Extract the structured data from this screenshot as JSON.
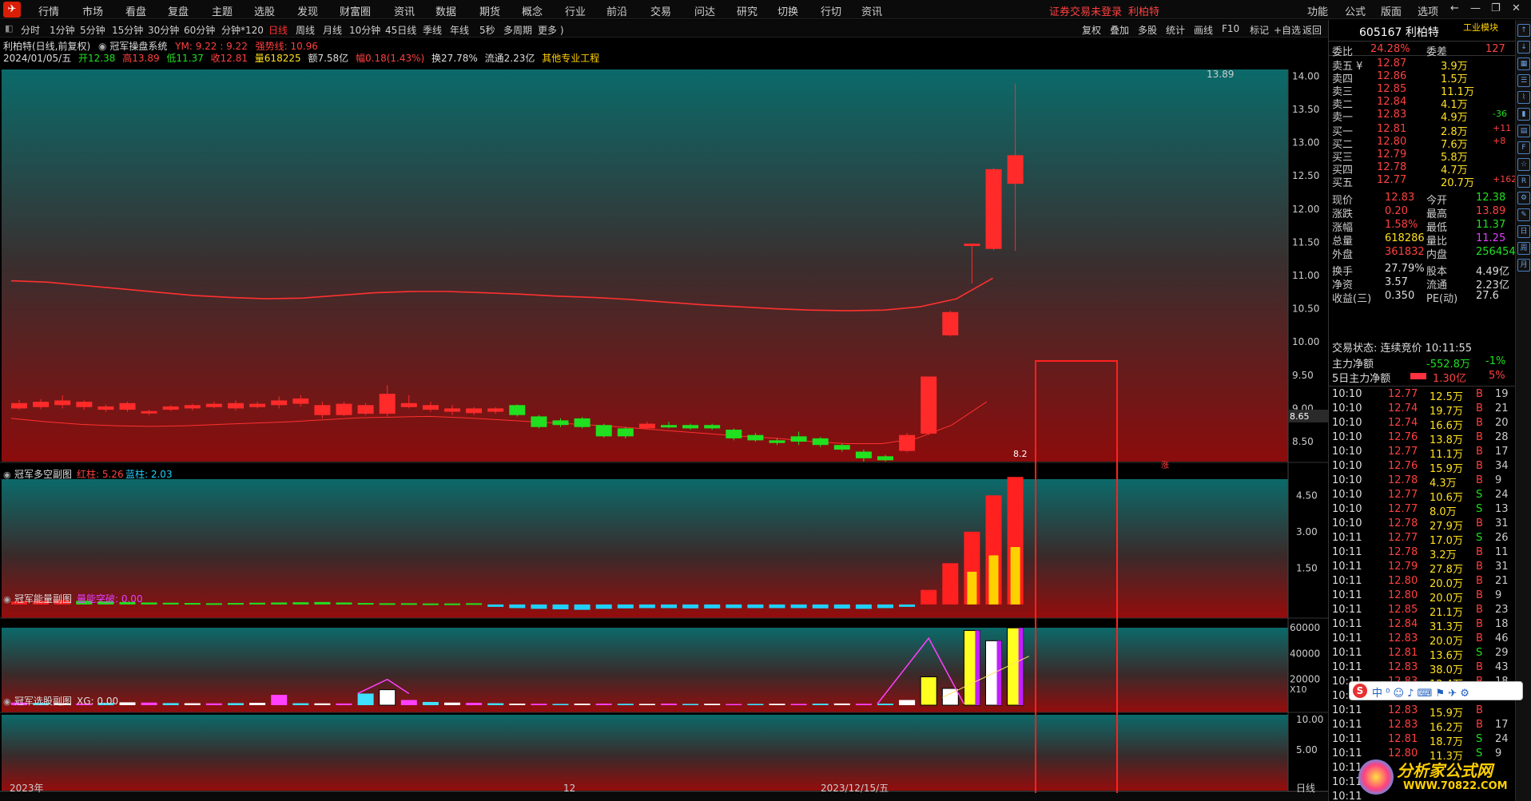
{
  "menu": [
    "行情",
    "市场",
    "看盘",
    "复盘",
    "主题",
    "选股",
    "发现",
    "财富圈",
    "资讯",
    "数据",
    "期货",
    "概念",
    "行业",
    "前沿",
    "交易",
    "问达",
    "研究",
    "切换",
    "行切",
    "资讯"
  ],
  "login_status": "证券交易未登录",
  "login_stock": "利柏特",
  "top_right_menu": [
    "功能",
    "公式",
    "版面",
    "选项"
  ],
  "timeframes": [
    "分时",
    "1分钟",
    "5分钟",
    "15分钟",
    "30分钟",
    "60分钟",
    "分钟*120",
    "日线",
    "周线",
    "月线",
    "10分钟",
    "45日线",
    "季线",
    "年线",
    "5秒",
    "多周期",
    "更多 )"
  ],
  "active_timeframe": "日线",
  "toolbar_right": [
    "复权",
    "叠加",
    "多股",
    "统计",
    "画线",
    "F10",
    "标记",
    "+自选",
    "返回"
  ],
  "stock": {
    "name": "利柏特",
    "code": "605167",
    "title": "605167 利柏特",
    "sector_tag": "工业模块",
    "chart_label": "利柏特(日线,前复权)",
    "system_name": "冠军操盘系统",
    "ym_label": "YM: 9.22 : 9.22",
    "strong_line": "强势线: 10.96",
    "date": "2024/01/05/五",
    "open": "开12.38",
    "high": "高13.89",
    "low": "低11.37",
    "close": "收12.81",
    "volume": "量618225",
    "amount": "额7.58亿",
    "amplitude": "幅0.18(1.43%)",
    "turnover": "换27.78%",
    "float_cap": "流通2.23亿",
    "extra": "其他专业工程"
  },
  "main_axis": [
    "14.00",
    "13.50",
    "13.00",
    "12.50",
    "12.00",
    "11.50",
    "11.00",
    "10.50",
    "10.00",
    "9.50",
    "9.00",
    "8.50"
  ],
  "price_marker": "8.65",
  "peak_label": "13.89",
  "low_label": "8.2",
  "zhang_label": "涨",
  "sub1": {
    "title": "冠军多空副图",
    "red_label": "红柱: 5.26",
    "blue_label": "蓝柱: 2.03",
    "axis": [
      "4.50",
      "3.00",
      "1.50"
    ]
  },
  "sub2": {
    "title": "冠军能量副图",
    "label": "量能突破: 0.00",
    "axis": [
      "60000",
      "40000",
      "20000"
    ],
    "unit": "X10"
  },
  "sub3": {
    "title": "冠军选股副图",
    "label": "XG: 0.00",
    "axis": [
      "10.00",
      "5.00"
    ]
  },
  "date_axis": [
    "2023年",
    "12",
    "2023/12/15/五",
    "日线"
  ],
  "order_book": {
    "weibi_label": "委比",
    "weibi": "24.28%",
    "weicha_label": "委差",
    "weicha": "127",
    "asks": [
      {
        "label": "卖五 ¥",
        "price": "12.87",
        "vol": "3.9万",
        "chg": ""
      },
      {
        "label": "卖四",
        "price": "12.86",
        "vol": "1.5万",
        "chg": ""
      },
      {
        "label": "卖三",
        "price": "12.85",
        "vol": "11.1万",
        "chg": ""
      },
      {
        "label": "卖二",
        "price": "12.84",
        "vol": "4.1万",
        "chg": ""
      },
      {
        "label": "卖一",
        "price": "12.83",
        "vol": "4.9万",
        "chg": "-36"
      }
    ],
    "bids": [
      {
        "label": "买一",
        "price": "12.81",
        "vol": "2.8万",
        "chg": "+11"
      },
      {
        "label": "买二",
        "price": "12.80",
        "vol": "7.6万",
        "chg": "+8"
      },
      {
        "label": "买三",
        "price": "12.79",
        "vol": "5.8万",
        "chg": ""
      },
      {
        "label": "买四",
        "price": "12.78",
        "vol": "4.7万",
        "chg": ""
      },
      {
        "label": "买五",
        "price": "12.77",
        "vol": "20.7万",
        "chg": "+162"
      }
    ]
  },
  "quote": [
    {
      "k1": "现价",
      "v1": "12.83",
      "k2": "今开",
      "v2": "12.38"
    },
    {
      "k1": "涨跌",
      "v1": "0.20",
      "k2": "最高",
      "v2": "13.89"
    },
    {
      "k1": "涨幅",
      "v1": "1.58%",
      "k2": "最低",
      "v2": "11.37"
    },
    {
      "k1": "总量",
      "v1": "618286",
      "k2": "量比",
      "v2": "11.25"
    },
    {
      "k1": "外盘",
      "v1": "361832",
      "k2": "内盘",
      "v2": "256454"
    },
    {
      "k1": "换手",
      "v1": "27.79%",
      "k2": "股本",
      "v2": "4.49亿"
    },
    {
      "k1": "净资",
      "v1": "3.57",
      "k2": "流通",
      "v2": "2.23亿"
    },
    {
      "k1": "收益(三)",
      "v1": "0.350",
      "k2": "PE(动)",
      "v2": "27.6"
    }
  ],
  "trade_status": "交易状态: 连续竞价 10:11:55",
  "main_net": {
    "label": "主力净额",
    "value": "-552.8万",
    "pct": "-1%"
  },
  "main_net5": {
    "label": "5日主力净额",
    "value": "1.30亿",
    "pct": "5%"
  },
  "ticks": [
    {
      "t": "10:10",
      "p": "12.77",
      "v": "12.5万",
      "s": "B",
      "n": "19"
    },
    {
      "t": "10:10",
      "p": "12.74",
      "v": "19.7万",
      "s": "B",
      "n": "21"
    },
    {
      "t": "10:10",
      "p": "12.74",
      "v": "16.6万",
      "s": "B",
      "n": "20"
    },
    {
      "t": "10:10",
      "p": "12.76",
      "v": "13.8万",
      "s": "B",
      "n": "28"
    },
    {
      "t": "10:10",
      "p": "12.77",
      "v": "11.1万",
      "s": "B",
      "n": "17"
    },
    {
      "t": "10:10",
      "p": "12.76",
      "v": "15.9万",
      "s": "B",
      "n": "34"
    },
    {
      "t": "10:10",
      "p": "12.78",
      "v": "4.3万",
      "s": "B",
      "n": "9"
    },
    {
      "t": "10:10",
      "p": "12.77",
      "v": "10.6万",
      "s": "S",
      "n": "24"
    },
    {
      "t": "10:10",
      "p": "12.77",
      "v": "8.0万",
      "s": "S",
      "n": "13"
    },
    {
      "t": "10:10",
      "p": "12.78",
      "v": "27.9万",
      "s": "B",
      "n": "31"
    },
    {
      "t": "10:11",
      "p": "12.77",
      "v": "17.0万",
      "s": "S",
      "n": "26"
    },
    {
      "t": "10:11",
      "p": "12.78",
      "v": "3.2万",
      "s": "B",
      "n": "11"
    },
    {
      "t": "10:11",
      "p": "12.79",
      "v": "27.8万",
      "s": "B",
      "n": "31"
    },
    {
      "t": "10:11",
      "p": "12.80",
      "v": "20.0万",
      "s": "B",
      "n": "21"
    },
    {
      "t": "10:11",
      "p": "12.80",
      "v": "20.0万",
      "s": "B",
      "n": "9"
    },
    {
      "t": "10:11",
      "p": "12.85",
      "v": "21.1万",
      "s": "B",
      "n": "23"
    },
    {
      "t": "10:11",
      "p": "12.84",
      "v": "31.3万",
      "s": "B",
      "n": "18"
    },
    {
      "t": "10:11",
      "p": "12.83",
      "v": "20.0万",
      "s": "B",
      "n": "46"
    },
    {
      "t": "10:11",
      "p": "12.81",
      "v": "13.6万",
      "s": "S",
      "n": "29"
    },
    {
      "t": "10:11",
      "p": "12.83",
      "v": "38.0万",
      "s": "B",
      "n": "43"
    },
    {
      "t": "10:11",
      "p": "12.83",
      "v": "12.4万",
      "s": "B",
      "n": "18"
    },
    {
      "t": "10:11",
      "p": "12.83",
      "v": "",
      "s": "",
      "n": ""
    },
    {
      "t": "10:11",
      "p": "12.83",
      "v": "15.9万",
      "s": "B",
      "n": ""
    },
    {
      "t": "10:11",
      "p": "12.83",
      "v": "16.2万",
      "s": "B",
      "n": "17"
    },
    {
      "t": "10:11",
      "p": "12.81",
      "v": "18.7万",
      "s": "S",
      "n": "24"
    },
    {
      "t": "10:11",
      "p": "12.80",
      "v": "11.3万",
      "s": "S",
      "n": "9"
    },
    {
      "t": "10:11",
      "p": "",
      "v": "",
      "s": "",
      "n": ""
    },
    {
      "t": "10:11",
      "p": "",
      "v": "",
      "s": "",
      "n": ""
    },
    {
      "t": "10:11",
      "p": "",
      "v": "",
      "s": "",
      "n": ""
    }
  ],
  "watermark": {
    "line1": "分析家公式网",
    "line2": "WWW.70822.COM"
  },
  "colors": {
    "up": "#ff2a2a",
    "down": "#20e020",
    "accent": "#ff3030",
    "cyan": "#00d8ff",
    "magenta": "#e020ff",
    "yellow": "#ffe020"
  },
  "chart_data": {
    "type": "candlestick",
    "price_ylim": [
      8.2,
      14.1
    ],
    "candles": [
      {
        "o": 9.0,
        "c": 9.08,
        "h": 9.13,
        "l": 8.98
      },
      {
        "o": 9.02,
        "c": 9.1,
        "h": 9.14,
        "l": 8.99
      },
      {
        "o": 9.05,
        "c": 9.12,
        "h": 9.2,
        "l": 9.0
      },
      {
        "o": 9.02,
        "c": 9.1,
        "h": 9.12,
        "l": 8.98
      },
      {
        "o": 8.98,
        "c": 9.03,
        "h": 9.06,
        "l": 8.95
      },
      {
        "o": 8.98,
        "c": 9.08,
        "h": 9.1,
        "l": 8.95
      },
      {
        "o": 8.93,
        "c": 8.96,
        "h": 8.98,
        "l": 8.9
      },
      {
        "o": 8.98,
        "c": 9.03,
        "h": 9.05,
        "l": 8.96
      },
      {
        "o": 9.0,
        "c": 9.05,
        "h": 9.07,
        "l": 8.97
      },
      {
        "o": 9.02,
        "c": 9.07,
        "h": 9.1,
        "l": 9.0
      },
      {
        "o": 9.0,
        "c": 9.08,
        "h": 9.12,
        "l": 8.97
      },
      {
        "o": 9.02,
        "c": 9.07,
        "h": 9.1,
        "l": 9.0
      },
      {
        "o": 9.05,
        "c": 9.12,
        "h": 9.18,
        "l": 9.0
      },
      {
        "o": 9.07,
        "c": 9.15,
        "h": 9.2,
        "l": 9.03
      },
      {
        "o": 8.9,
        "c": 9.05,
        "h": 9.1,
        "l": 8.85
      },
      {
        "o": 8.9,
        "c": 9.07,
        "h": 9.1,
        "l": 8.88
      },
      {
        "o": 8.92,
        "c": 9.05,
        "h": 9.08,
        "l": 8.9
      },
      {
        "o": 8.92,
        "c": 9.22,
        "h": 9.35,
        "l": 8.88
      },
      {
        "o": 9.02,
        "c": 9.08,
        "h": 9.2,
        "l": 9.0
      },
      {
        "o": 8.98,
        "c": 9.05,
        "h": 9.1,
        "l": 8.95
      },
      {
        "o": 8.95,
        "c": 9.0,
        "h": 9.05,
        "l": 8.9
      },
      {
        "o": 8.93,
        "c": 9.0,
        "h": 9.02,
        "l": 8.9
      },
      {
        "o": 8.95,
        "c": 9.0,
        "h": 9.02,
        "l": 8.92
      },
      {
        "o": 9.05,
        "c": 8.9,
        "h": 9.06,
        "l": 8.88
      },
      {
        "o": 8.88,
        "c": 8.72,
        "h": 8.9,
        "l": 8.7
      },
      {
        "o": 8.82,
        "c": 8.75,
        "h": 8.85,
        "l": 8.72
      },
      {
        "o": 8.85,
        "c": 8.72,
        "h": 8.87,
        "l": 8.7
      },
      {
        "o": 8.75,
        "c": 8.58,
        "h": 8.77,
        "l": 8.56
      },
      {
        "o": 8.7,
        "c": 8.58,
        "h": 8.72,
        "l": 8.55
      },
      {
        "o": 8.7,
        "c": 8.77,
        "h": 8.8,
        "l": 8.68
      },
      {
        "o": 8.75,
        "c": 8.72,
        "h": 8.8,
        "l": 8.7
      },
      {
        "o": 8.75,
        "c": 8.7,
        "h": 8.77,
        "l": 8.68
      },
      {
        "o": 8.75,
        "c": 8.7,
        "h": 8.77,
        "l": 8.68
      },
      {
        "o": 8.68,
        "c": 8.55,
        "h": 8.7,
        "l": 8.52
      },
      {
        "o": 8.6,
        "c": 8.52,
        "h": 8.63,
        "l": 8.5
      },
      {
        "o": 8.52,
        "c": 8.48,
        "h": 8.55,
        "l": 8.45
      },
      {
        "o": 8.58,
        "c": 8.5,
        "h": 8.65,
        "l": 8.45
      },
      {
        "o": 8.55,
        "c": 8.45,
        "h": 8.57,
        "l": 8.42
      },
      {
        "o": 8.45,
        "c": 8.38,
        "h": 8.47,
        "l": 8.35
      },
      {
        "o": 8.35,
        "c": 8.25,
        "h": 8.38,
        "l": 8.2
      },
      {
        "o": 8.28,
        "c": 8.22,
        "h": 8.3,
        "l": 8.2
      },
      {
        "o": 8.36,
        "c": 8.6,
        "h": 8.63,
        "l": 8.34
      },
      {
        "o": 8.62,
        "c": 9.48,
        "h": 9.48,
        "l": 8.6
      },
      {
        "o": 10.1,
        "c": 10.45,
        "h": 10.47,
        "l": 10.08
      },
      {
        "o": 11.48,
        "c": 11.48,
        "h": 11.48,
        "l": 10.88
      },
      {
        "o": 11.4,
        "c": 12.6,
        "h": 12.62,
        "l": 11.38
      },
      {
        "o": 12.38,
        "c": 12.81,
        "h": 13.89,
        "l": 11.37
      }
    ],
    "strong_line": [
      10.92,
      10.9,
      10.85,
      10.8,
      10.75,
      10.7,
      10.67,
      10.65,
      10.66,
      10.7,
      10.74,
      10.76,
      10.76,
      10.74,
      10.72,
      10.69,
      10.67,
      10.64,
      10.6,
      10.56,
      10.53,
      10.5,
      10.48,
      10.47,
      10.48,
      10.53,
      10.65,
      10.96
    ],
    "ma_line": [
      8.85,
      8.8,
      8.76,
      8.74,
      8.73,
      8.74,
      8.76,
      8.78,
      8.8,
      8.83,
      8.86,
      8.87,
      8.88,
      8.86,
      8.83,
      8.8,
      8.77,
      8.74,
      8.7,
      8.66,
      8.62,
      8.58,
      8.55,
      8.5,
      8.47,
      8.47,
      8.55,
      8.75,
      9.1
    ],
    "sub1_bars": [
      0.12,
      0.15,
      0.17,
      0.15,
      0.13,
      0.1,
      0.08,
      0.07,
      0.06,
      0.05,
      0.06,
      0.07,
      0.08,
      0.09,
      0.1,
      0.08,
      0.06,
      0.05,
      0.05,
      0.04,
      0.04,
      0.05,
      -0.1,
      -0.15,
      -0.18,
      -0.2,
      -0.22,
      -0.18,
      -0.16,
      -0.15,
      -0.15,
      -0.16,
      -0.16,
      -0.15,
      -0.15,
      -0.15,
      -0.15,
      -0.16,
      -0.17,
      -0.18,
      -0.15,
      -0.1,
      0.6,
      1.7,
      3.0,
      4.5,
      5.26
    ],
    "sub1_ylim": [
      -0.3,
      5.3
    ],
    "sub2_bars": [
      2000,
      1800,
      1500,
      1200,
      1800,
      2200,
      2000,
      1600,
      1500,
      1400,
      1600,
      1800,
      8000,
      1500,
      1400,
      1300,
      9000,
      12000,
      4000,
      2500,
      2000,
      1800,
      1500,
      1200,
      1100,
      1000,
      1200,
      1200,
      1100,
      1000,
      1200,
      1000,
      1100,
      900,
      1000,
      1100,
      1000,
      1200,
      1300,
      1100,
      1200,
      4000,
      22000,
      13000,
      58000,
      50000,
      60000
    ],
    "sub2_ylim": [
      0,
      62000
    ]
  }
}
